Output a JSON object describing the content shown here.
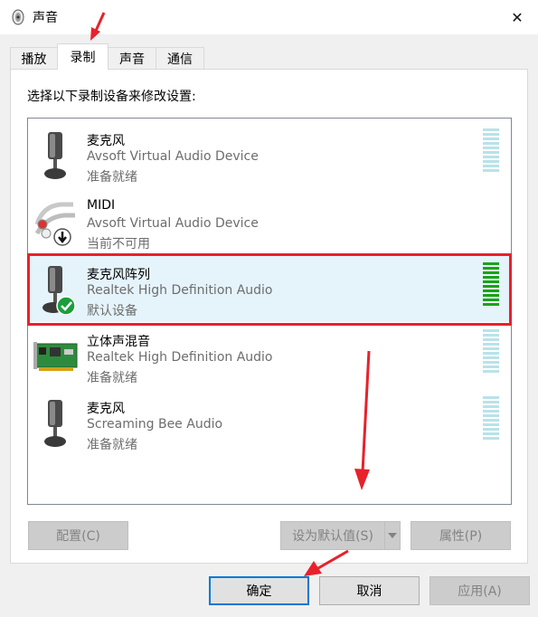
{
  "window": {
    "title": "声音",
    "close_glyph": "✕"
  },
  "tabs": [
    {
      "label": "播放",
      "active": false
    },
    {
      "label": "录制",
      "active": true
    },
    {
      "label": "声音",
      "active": false
    },
    {
      "label": "通信",
      "active": false
    }
  ],
  "instruction": "选择以下录制设备来修改设置:",
  "devices": [
    {
      "name": "麦克风",
      "description": "Avsoft Virtual Audio Device",
      "status": "准备就绪",
      "icon": "microphone-icon"
    },
    {
      "name": "MIDI",
      "description": "Avsoft Virtual Audio Device",
      "status": "当前不可用",
      "icon": "midi-cable-icon"
    },
    {
      "name": "麦克风阵列",
      "description": "Realtek High Definition Audio",
      "status": "默认设备",
      "icon": "microphone-icon",
      "selected": true,
      "level": 1.0
    },
    {
      "name": "立体声混音",
      "description": "Realtek High Definition Audio",
      "status": "准备就绪",
      "icon": "sound-card-icon"
    },
    {
      "name": "麦克风",
      "description": "Screaming Bee Audio",
      "status": "准备就绪",
      "icon": "microphone-icon"
    }
  ],
  "buttons": {
    "configure": "配置(C)",
    "set_default": "设为默认值(S)",
    "properties": "属性(P)",
    "ok": "确定",
    "cancel": "取消",
    "apply": "应用(A)"
  },
  "colors": {
    "accent": "#0078d7",
    "annotation_red": "#e8212b",
    "meter_active": "#1aa31a",
    "meter_idle": "#b9e2ea"
  }
}
